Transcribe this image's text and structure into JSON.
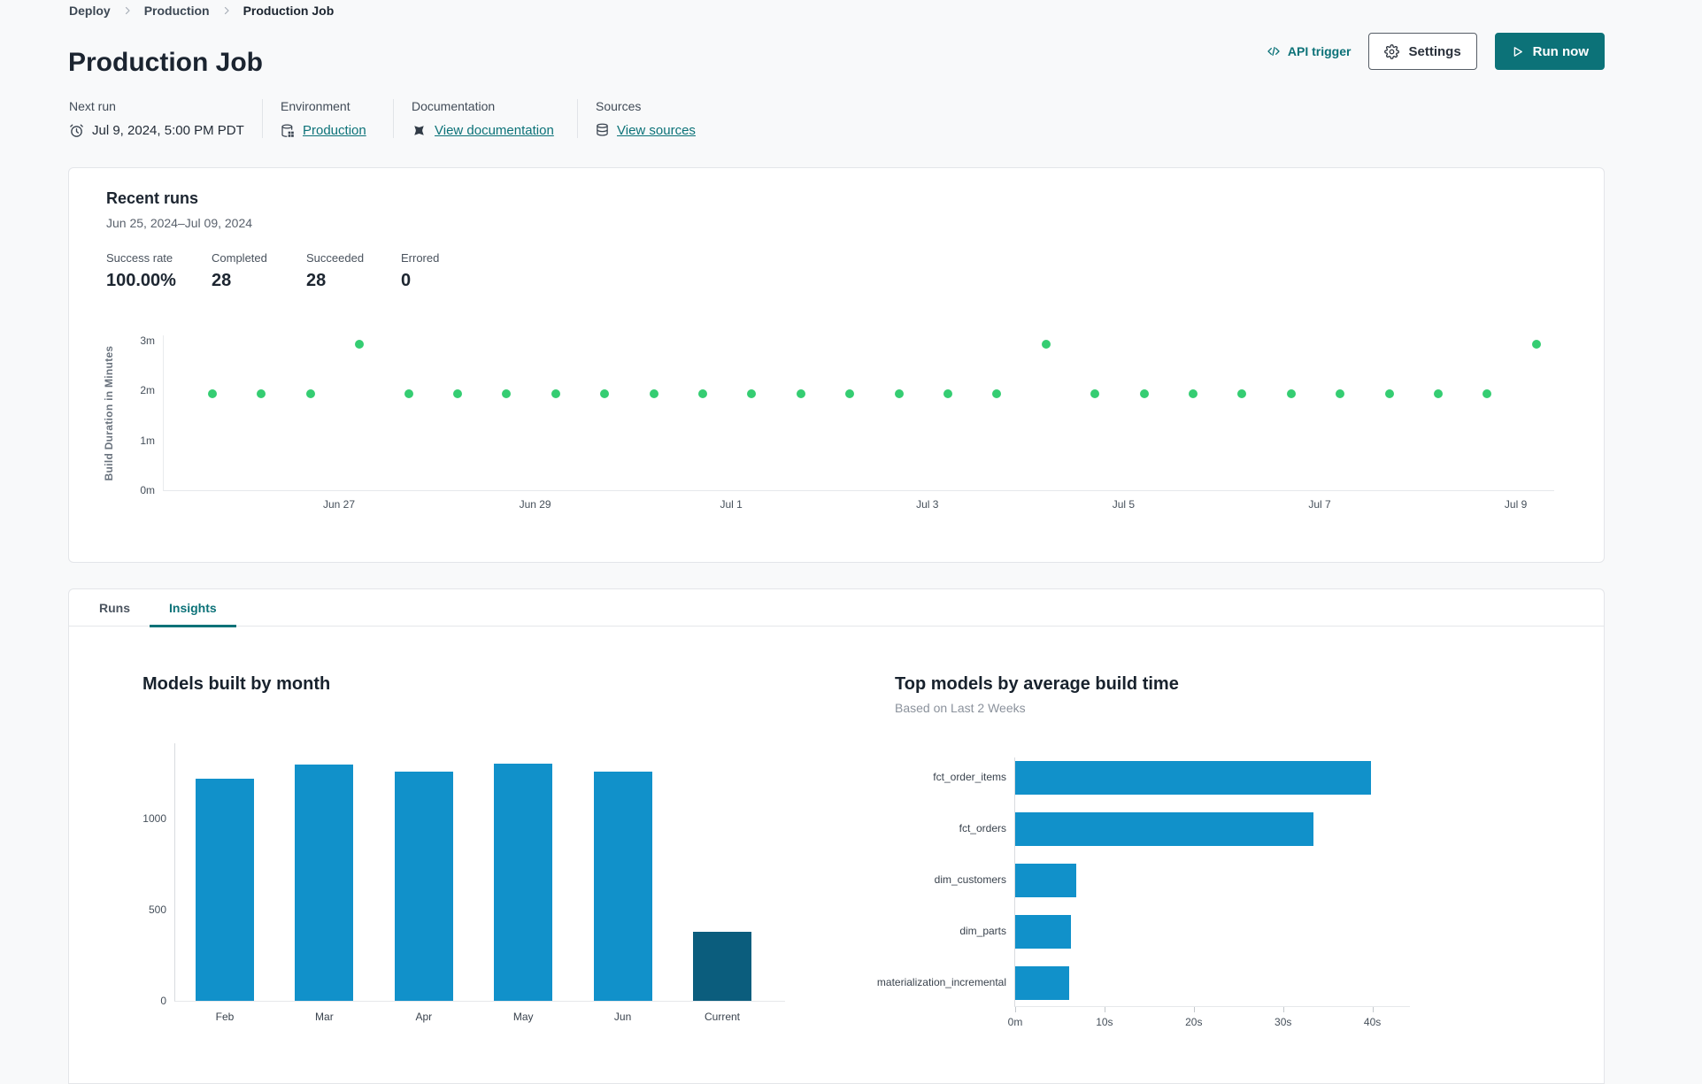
{
  "breadcrumb": {
    "separator": "›",
    "items": [
      "Deploy",
      "Production",
      "Production Job"
    ]
  },
  "header": {
    "title": "Production Job",
    "api_trigger_label": "API trigger",
    "settings_label": "Settings",
    "run_now_label": "Run now"
  },
  "meta": {
    "next_run": {
      "label": "Next run",
      "value": "Jul 9, 2024, 5:00 PM PDT"
    },
    "environment": {
      "label": "Environment",
      "value": "Production"
    },
    "documentation": {
      "label": "Documentation",
      "value": "View documentation"
    },
    "sources": {
      "label": "Sources",
      "value": "View sources"
    }
  },
  "recent_runs": {
    "title": "Recent runs",
    "date_range": "Jun 25, 2024–Jul 09, 2024",
    "stats": [
      {
        "label": "Success rate",
        "value": "100.00%"
      },
      {
        "label": "Completed",
        "value": "28"
      },
      {
        "label": "Succeeded",
        "value": "28"
      },
      {
        "label": "Errored",
        "value": "0"
      }
    ]
  },
  "tabs": [
    {
      "label": "Runs"
    },
    {
      "label": "Insights"
    }
  ],
  "colors": {
    "accent_teal": "#0c7278",
    "dot_green": "#35cd72",
    "bar_blue": "#1191ca",
    "bar_dark_blue": "#0b5d7d"
  },
  "chart_data": [
    {
      "name": "build-duration-scatter",
      "type": "scatter",
      "ylabel": "Build Duration in Minutes",
      "ylim": [
        0,
        3.12
      ],
      "y_tick_labels": [
        "0m",
        "1m",
        "2m",
        "3m"
      ],
      "x_tick_labels": [
        "Jun 27",
        "Jun 29",
        "Jul 1",
        "Jul 3",
        "Jul 5",
        "Jul 7",
        "Jul 9"
      ],
      "x_start": "Jun 25, 2024 5:00 PM PDT",
      "x_interval_hours": 12,
      "point_color": "#35cd72",
      "durations_minutes": [
        1.95,
        1.95,
        1.95,
        2.95,
        1.95,
        1.95,
        1.95,
        1.95,
        1.95,
        1.95,
        1.95,
        1.95,
        1.95,
        1.95,
        1.95,
        1.95,
        1.95,
        2.95,
        1.95,
        1.95,
        1.95,
        1.95,
        1.95,
        1.95,
        1.95,
        1.95,
        1.95,
        2.95
      ],
      "grid": false,
      "legend": false
    },
    {
      "name": "models-built-by-month",
      "type": "bar",
      "title": "Models built by month",
      "categories": [
        "Feb",
        "Mar",
        "Apr",
        "May",
        "Jun",
        "Current"
      ],
      "values": [
        1220,
        1300,
        1260,
        1305,
        1260,
        380
      ],
      "y_ticks": [
        0,
        500,
        1000
      ],
      "ylim": [
        0,
        1420
      ],
      "bar_color": "#1191ca",
      "highlight_color": "#0b5d7d",
      "highlight_category": "Current",
      "grid": false,
      "legend": false
    },
    {
      "name": "top-models-by-avg-build-time",
      "type": "bar-horizontal",
      "title": "Top models by average build time",
      "subtitle": "Based on Last 2 Weeks",
      "categories": [
        "fct_order_items",
        "fct_orders",
        "dim_customers",
        "dim_parts",
        "materialization_incremental"
      ],
      "values_seconds": [
        39.8,
        33.4,
        6.8,
        6.2,
        6.0
      ],
      "x_ticks": [
        0,
        10,
        20,
        30,
        40
      ],
      "x_tick_labels": [
        "0m",
        "10s",
        "20s",
        "30s",
        "40s"
      ],
      "xlim": [
        0,
        44.3
      ],
      "bar_color": "#1191ca",
      "grid": false,
      "legend": false
    }
  ]
}
